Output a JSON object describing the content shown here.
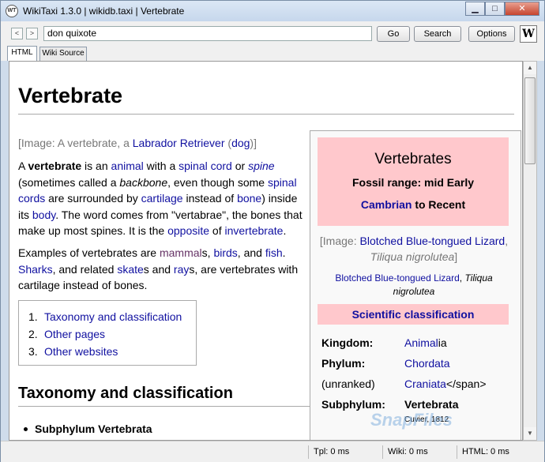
{
  "window": {
    "title": "WikiTaxi 1.3.0 | wikidb.taxi | Vertebrate"
  },
  "toolbar": {
    "search_value": "don quixote",
    "go": "Go",
    "search": "Search",
    "options": "Options",
    "back": "<",
    "forward": ">",
    "logo": "W"
  },
  "tabs": [
    "HTML",
    "Wiki Source"
  ],
  "article": {
    "title": "Vertebrate",
    "image_caption": {
      "prefix": "[Image: A vertebrate, a ",
      "link1": "Labrador Retriever",
      "mid": " (",
      "link2": "dog",
      "suffix": ")]"
    },
    "p1": {
      "t1": "A ",
      "b1": "vertebrate",
      "t2": " is an ",
      "l1": "animal",
      "t3": " with a ",
      "l2": "spinal cord",
      "t4": " or ",
      "l3": "spine",
      "t5": " (sometimes called a ",
      "i1": "backbone",
      "t6": ", even though some ",
      "l4": "spinal cords",
      "t7": " are surrounded by ",
      "l5": "cartilage",
      "t8": " instead of ",
      "l6": "bone",
      "t9": ") inside its ",
      "l7": "body",
      "t10": ". The word comes from \"vertabrae\", the bones that make up most spines. It is the ",
      "l8": "opposite",
      "t11": " of ",
      "l9": "invertebrate",
      "t12": "."
    },
    "p2": {
      "t1": "Examples of vertebrates are ",
      "l1": "mammal",
      "t2": "s, ",
      "l2": "birds",
      "t3": ", and ",
      "l3": "fish",
      "t4": ". ",
      "l4": "Sharks",
      "t5": ", and related ",
      "l5": "skate",
      "t6": "s and ",
      "l6": "ray",
      "t7": "s, are vertebrates with cartilage instead of bones."
    },
    "toc": [
      {
        "num": "1.",
        "label": "Taxonomy and classification"
      },
      {
        "num": "2.",
        "label": "Other pages"
      },
      {
        "num": "3.",
        "label": "Other websites"
      }
    ],
    "section_heading": "Taxonomy and classification",
    "bullet": "Subphylum Vertebrata"
  },
  "infobox": {
    "title": "Vertebrates",
    "fossil_range": "Fossil range: mid Early",
    "range_link": "Cambrian",
    "range_rest": " to Recent",
    "image_prefix": "[Image: ",
    "image_link": "Blotched Blue-tongued Lizard",
    "image_comma": ",",
    "image_italic": "Tiliqua nigrolutea",
    "image_suffix": "]",
    "cap_link": "Blotched Blue-tongued Lizard",
    "cap_comma": ", ",
    "cap_italic": "Tiliqua nigrolutea",
    "sci_class": "Scientific classification",
    "rows": [
      {
        "key": "Kingdom:",
        "link": "Animal",
        "rest": "ia"
      },
      {
        "key": "Phylum:",
        "link": "Chordata",
        "rest": ""
      },
      {
        "key": "(unranked)",
        "link": "Craniata",
        "rest": "</span>"
      },
      {
        "key": "Subphylum:",
        "link": "",
        "rest": "Vertebrata"
      }
    ],
    "authority": "Cuvier, 1812"
  },
  "status": {
    "tpl": "Tpl: 0 ms",
    "wiki": "Wiki: 0 ms",
    "html": "HTML: 0 ms"
  },
  "watermark": "SnapFiles",
  "app_icon": "WT"
}
